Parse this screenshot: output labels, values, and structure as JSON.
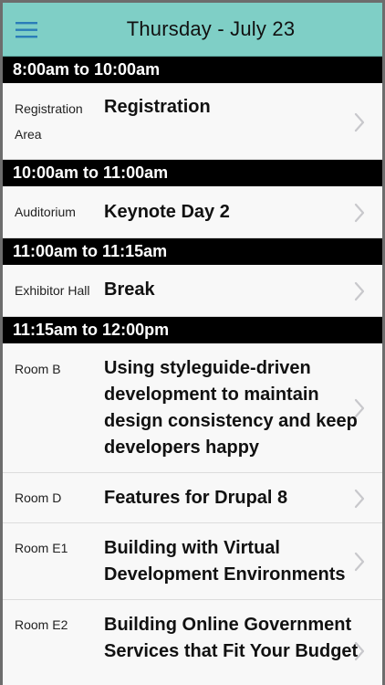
{
  "header": {
    "title": "Thursday - July 23",
    "menu_icon": "hamburger-menu-icon",
    "accent_color": "#7fcfc6"
  },
  "slots": [
    {
      "time": "8:00am to 10:00am",
      "sessions": [
        {
          "room": "Registration Area",
          "title": "Registration"
        }
      ]
    },
    {
      "time": "10:00am to 11:00am",
      "sessions": [
        {
          "room": "Auditorium",
          "title": "Keynote Day 2"
        }
      ]
    },
    {
      "time": "11:00am to 11:15am",
      "sessions": [
        {
          "room": "Exhibitor Hall",
          "title": "Break"
        }
      ]
    },
    {
      "time": "11:15am to 12:00pm",
      "sessions": [
        {
          "room": "Room B",
          "title": "Using styleguide-driven development to maintain design consistency and keep developers happy"
        },
        {
          "room": "Room D",
          "title": "Features for Drupal 8"
        },
        {
          "room": "Room E1",
          "title": "Building with Virtual Development Environments"
        },
        {
          "room": "Room E2",
          "title": "Building Online Government Services that Fit Your Budget"
        }
      ]
    }
  ],
  "chevron_icon": "chevron-right-icon"
}
